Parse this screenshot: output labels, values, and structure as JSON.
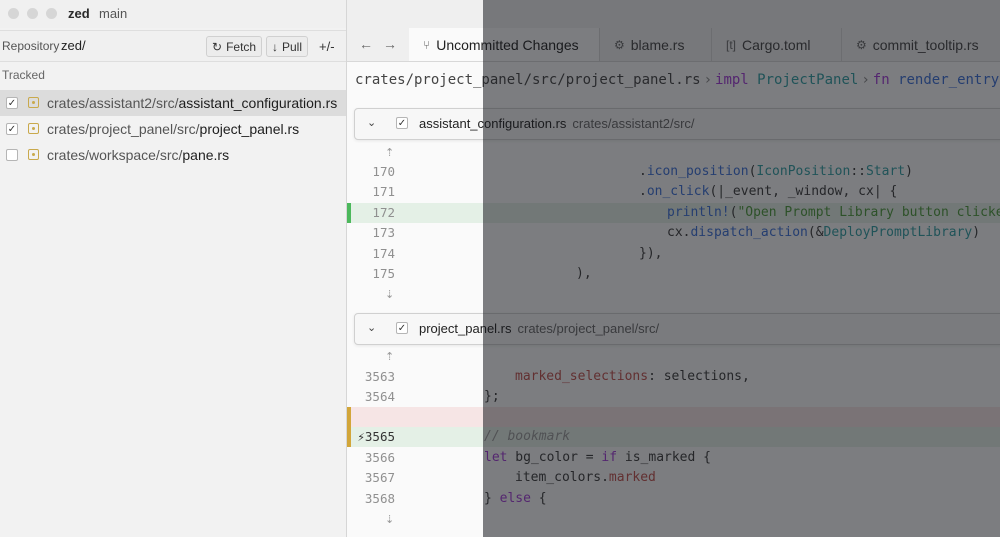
{
  "titlebar": {
    "repo": "zed",
    "branch": "main"
  },
  "git_panel": {
    "repository_label": "Repository",
    "repository_name": "zed/",
    "fetch_label": "Fetch",
    "pull_label": "Pull",
    "diff_toggle_label": "+/-",
    "tracked_header": "Tracked",
    "files": [
      {
        "dir": "crates/assistant2/src/",
        "name": "assistant_configuration.rs",
        "checked": true
      },
      {
        "dir": "crates/project_panel/src/",
        "name": "project_panel.rs",
        "checked": true
      },
      {
        "dir": "crates/workspace/src/",
        "name": "pane.rs",
        "checked": false
      }
    ]
  },
  "tabs": [
    {
      "label": "Uncommitted Changes",
      "icon": "git-branch-icon"
    },
    {
      "label": "blame.rs",
      "icon": "rust-file-icon"
    },
    {
      "label": "Cargo.toml",
      "icon": "toml-file-icon"
    },
    {
      "label": "commit_tooltip.rs",
      "icon": "rust-file-icon"
    }
  ],
  "breadcrumb": {
    "path": "crates/project_panel/src/project_panel.rs",
    "impl_kw": "impl",
    "impl_type": "ProjectPanel",
    "fn_kw": "fn",
    "fn_name": "render_entry"
  },
  "hunks": [
    {
      "file": "assistant_configuration.rs",
      "dir": "crates/assistant2/src/",
      "lines": [
        {
          "n": "170",
          "status": "context"
        },
        {
          "n": "171",
          "status": "context"
        },
        {
          "n": "172",
          "status": "added"
        },
        {
          "n": "173",
          "status": "context"
        },
        {
          "n": "174",
          "status": "context"
        },
        {
          "n": "175",
          "status": "context"
        }
      ]
    },
    {
      "file": "project_panel.rs",
      "dir": "crates/project_panel/src/",
      "lines": [
        {
          "n": "3563",
          "status": "context"
        },
        {
          "n": "3564",
          "status": "context"
        },
        {
          "n": "",
          "status": "removed"
        },
        {
          "n": "3565",
          "status": "added"
        },
        {
          "n": "3566",
          "status": "context"
        },
        {
          "n": "3567",
          "status": "context"
        },
        {
          "n": "3568",
          "status": "context"
        }
      ]
    }
  ],
  "colors": {
    "added": "#4cb85c",
    "modified": "#c9a94c",
    "keyword": "#a23bd6",
    "function": "#3b6fd8",
    "type": "#2f9ea3",
    "string": "#4d9a3b"
  }
}
